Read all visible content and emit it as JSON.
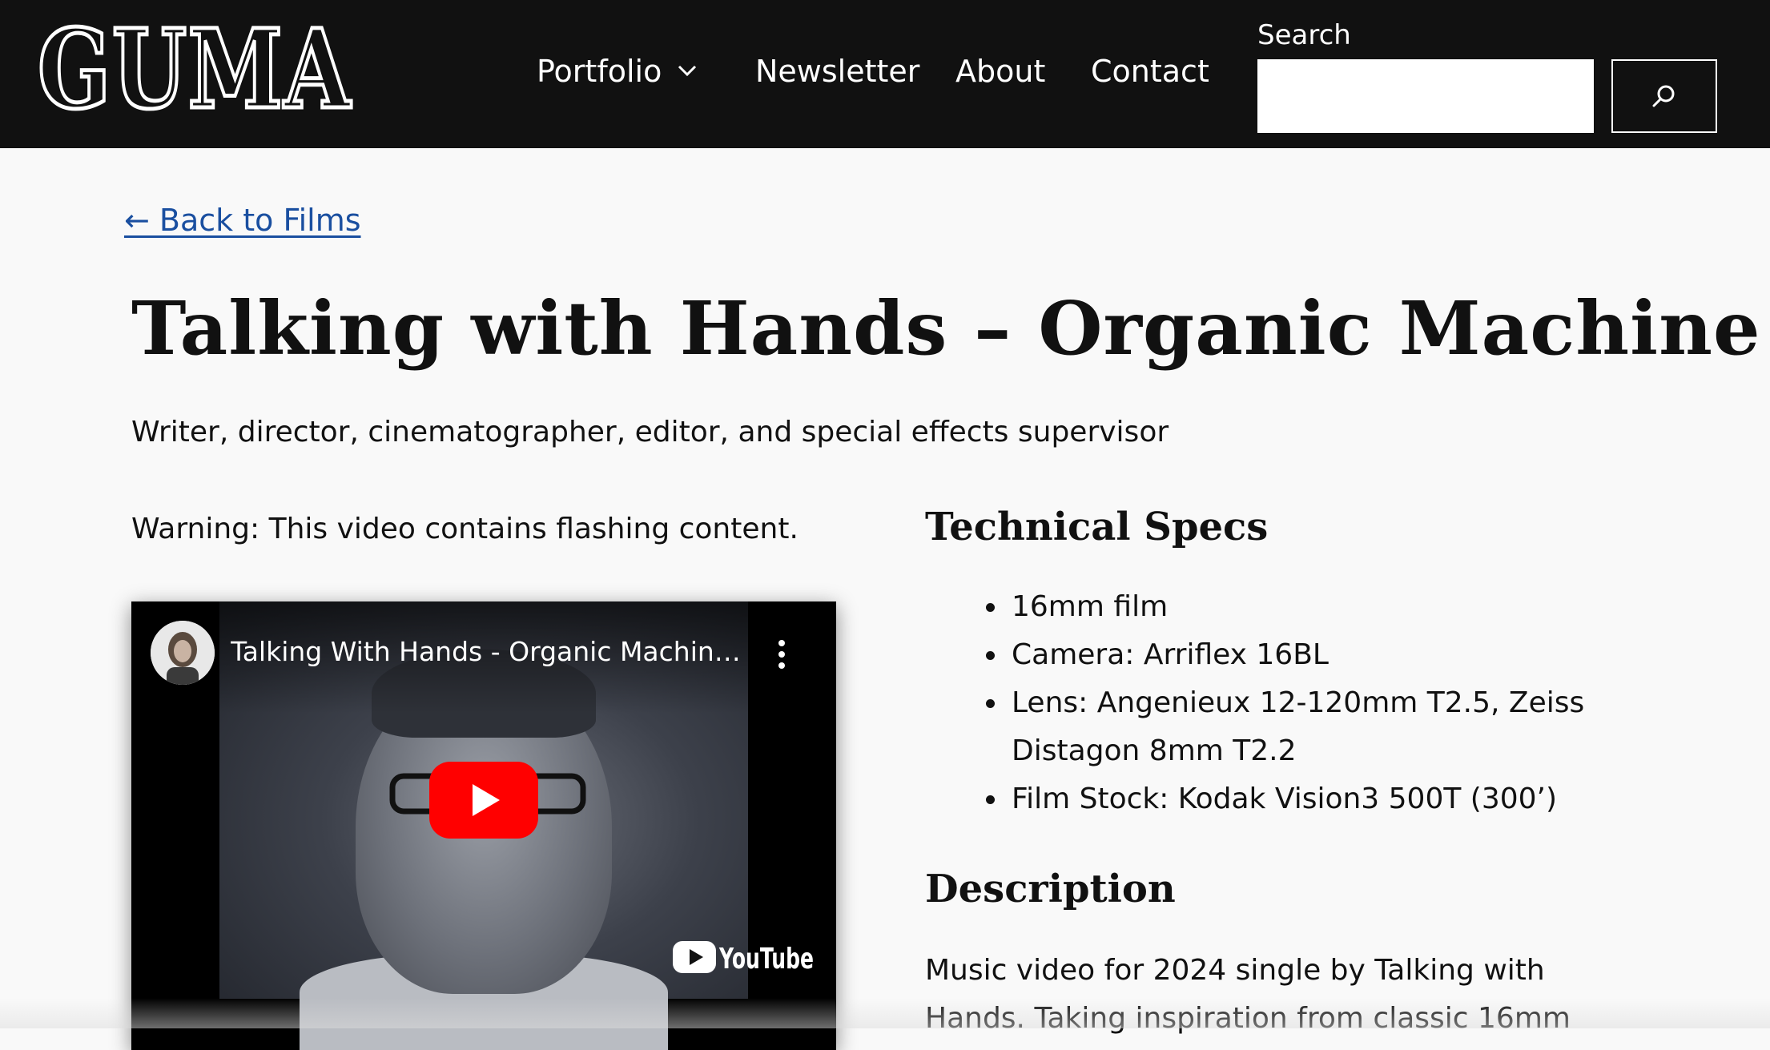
{
  "header": {
    "logo_text": "GUMA",
    "nav": [
      {
        "label": "Portfolio",
        "has_dropdown": true
      },
      {
        "label": "Newsletter"
      },
      {
        "label": "About"
      },
      {
        "label": "Contact"
      }
    ],
    "search": {
      "label": "Search",
      "value": "",
      "button_icon": "search-icon"
    }
  },
  "main": {
    "back_link": "← Back to Films",
    "title": "Talking with Hands – Organic Machine",
    "subtitle": "Writer, director, cinematographer, editor, and special effects supervisor",
    "warning": "Warning: This video contains flashing content.",
    "video": {
      "title": "Talking With Hands - Organic Machine...",
      "brand": "YouTube",
      "play_icon": "play-icon",
      "menu_icon": "more-vert-icon"
    },
    "specs": {
      "heading": "Technical Specs",
      "items": [
        "16mm film",
        "Camera: Arriflex 16BL",
        "Lens: Angenieux 12-120mm T2.5, Zeiss Distagon 8mm T2.2",
        "Film Stock: Kodak Vision3 500T (300’)"
      ]
    },
    "description": {
      "heading": "Description",
      "text": "Music video for 2024 single by Talking with Hands. Taking inspiration from classic 16mm"
    }
  },
  "colors": {
    "header_bg": "#111111",
    "page_bg": "#f9f9f9",
    "link": "#1a4fa0",
    "youtube_red": "#ff0000"
  }
}
